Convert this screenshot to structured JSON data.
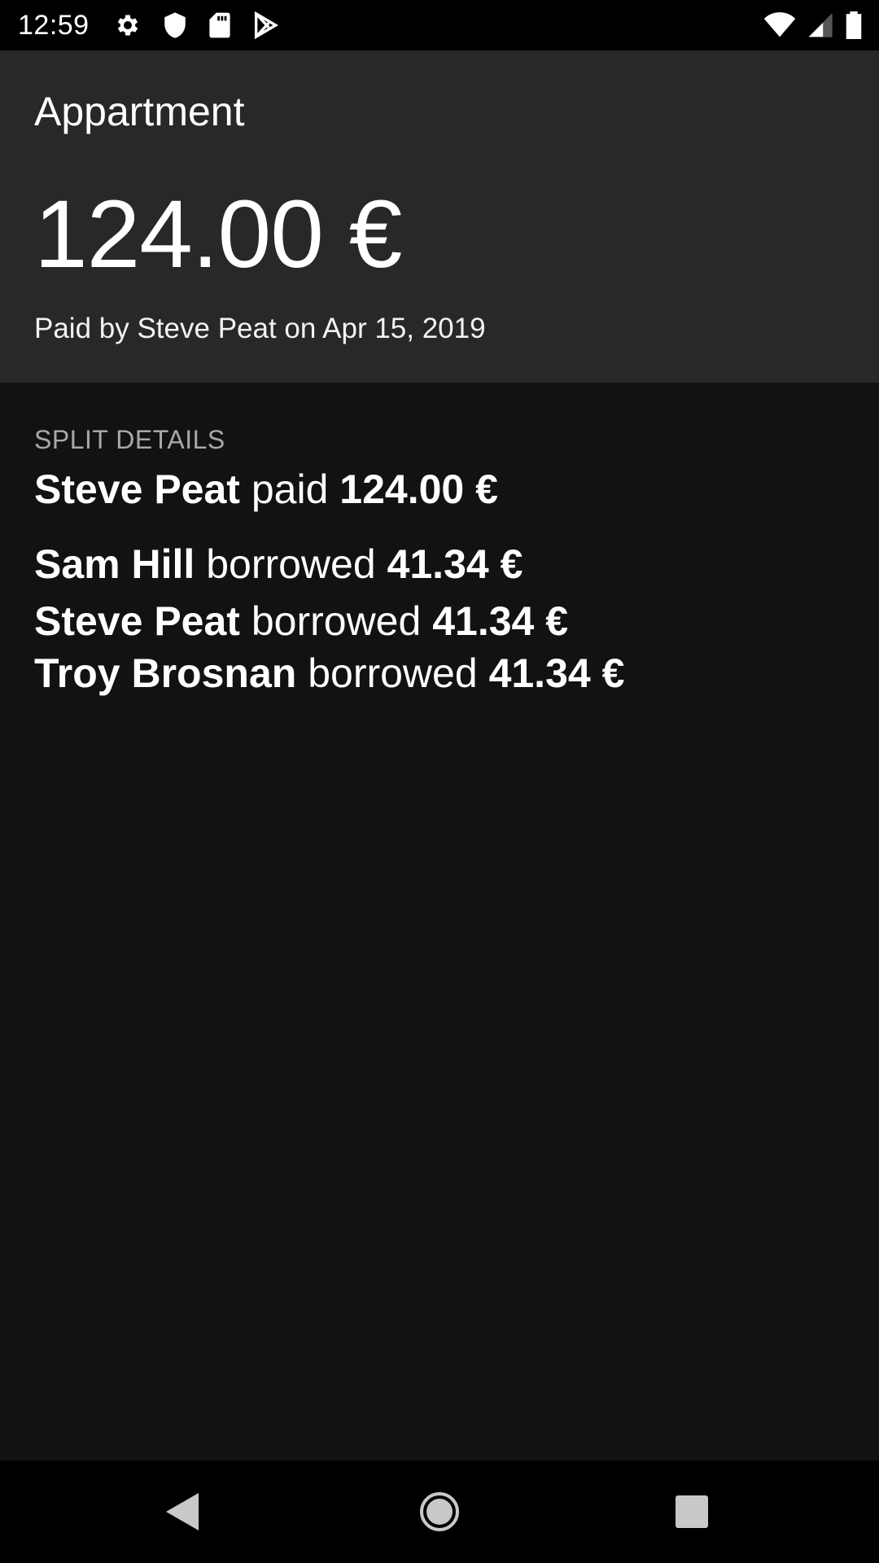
{
  "status_bar": {
    "time": "12:59",
    "left_icons": [
      "gear-icon",
      "shield-icon",
      "sd-card-icon",
      "play-store-icon"
    ],
    "right_icons": [
      "wifi-icon",
      "cell-signal-icon",
      "battery-icon"
    ]
  },
  "expense": {
    "title": "Appartment",
    "amount": "124.00 €",
    "paid_by": "Paid by Steve Peat on Apr 15, 2019"
  },
  "split": {
    "header": "SPLIT DETAILS",
    "payer": {
      "name": "Steve Peat",
      "verb": "paid",
      "amount": "124.00 €"
    },
    "borrowers": [
      {
        "name": "Sam Hill",
        "verb": "borrowed",
        "amount": "41.34 €"
      },
      {
        "name": "Steve Peat",
        "verb": "borrowed",
        "amount": "41.34 €"
      },
      {
        "name": "Troy Brosnan",
        "verb": "borrowed",
        "amount": "41.34 €"
      }
    ]
  },
  "nav_bar": {
    "icons": [
      "back-icon",
      "home-icon",
      "recents-icon"
    ]
  },
  "colors": {
    "background": "#121212",
    "header_background": "#282828",
    "bar_background": "#000000",
    "secondary_text": "#a8a8a8"
  }
}
